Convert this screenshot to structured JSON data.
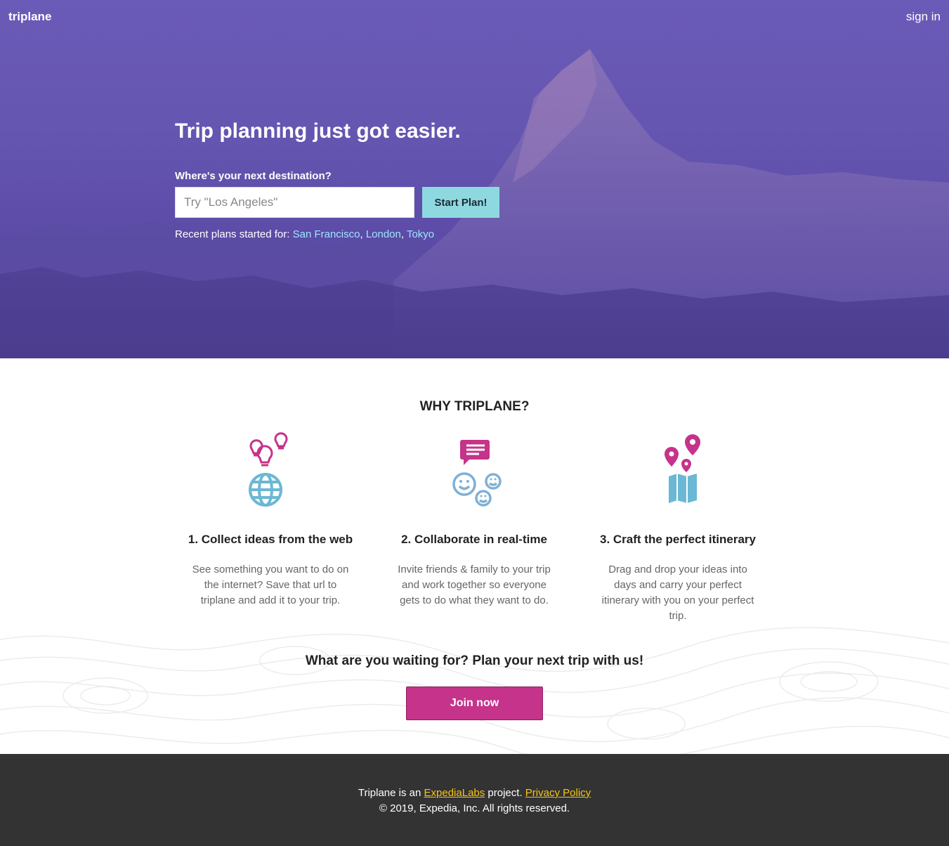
{
  "header": {
    "brand": "triplane",
    "sign_in": "sign in"
  },
  "hero": {
    "title": "Trip planning just got easier.",
    "destination_label": "Where's your next destination?",
    "destination_placeholder": "Try \"Los Angeles\"",
    "start_button": "Start Plan!",
    "recent_prefix": "Recent plans started for:",
    "recent_cities": [
      "San Francisco",
      "London",
      "Tokyo"
    ],
    "recent_separator": ","
  },
  "why": {
    "title": "WHY TRIPLANE?",
    "features": [
      {
        "icon": "lightbulbs-globe-icon",
        "title": "1. Collect ideas from the web",
        "text": "See something you want to do on the internet? Save that url to triplane and add it to your trip."
      },
      {
        "icon": "chat-faces-icon",
        "title": "2. Collaborate in real-time",
        "text": "Invite friends & family to your trip and work together so everyone gets to do what they want to do."
      },
      {
        "icon": "map-pins-icon",
        "title": "3. Craft the perfect itinerary",
        "text": "Drag and drop your ideas into days and carry your perfect itinerary with you on your perfect trip."
      }
    ]
  },
  "cta": {
    "title": "What are you waiting for? Plan your next trip with us!",
    "button": "Join now"
  },
  "footer": {
    "prefix": "Triplane is an",
    "expedia_link": "ExpediaLabs",
    "middle": "project.",
    "privacy_link": "Privacy Policy",
    "copyright": "© 2019, Expedia, Inc. All rights reserved."
  },
  "colors": {
    "hero_purple": "#6455b0",
    "start_button": "#8ed9e0",
    "join_button": "#c5338a",
    "link_cyan": "#9ee6ff",
    "footer_bg": "#333333",
    "footer_link": "#f5c518",
    "icon_pink": "#c5338a",
    "icon_blue": "#6bb8d4"
  }
}
